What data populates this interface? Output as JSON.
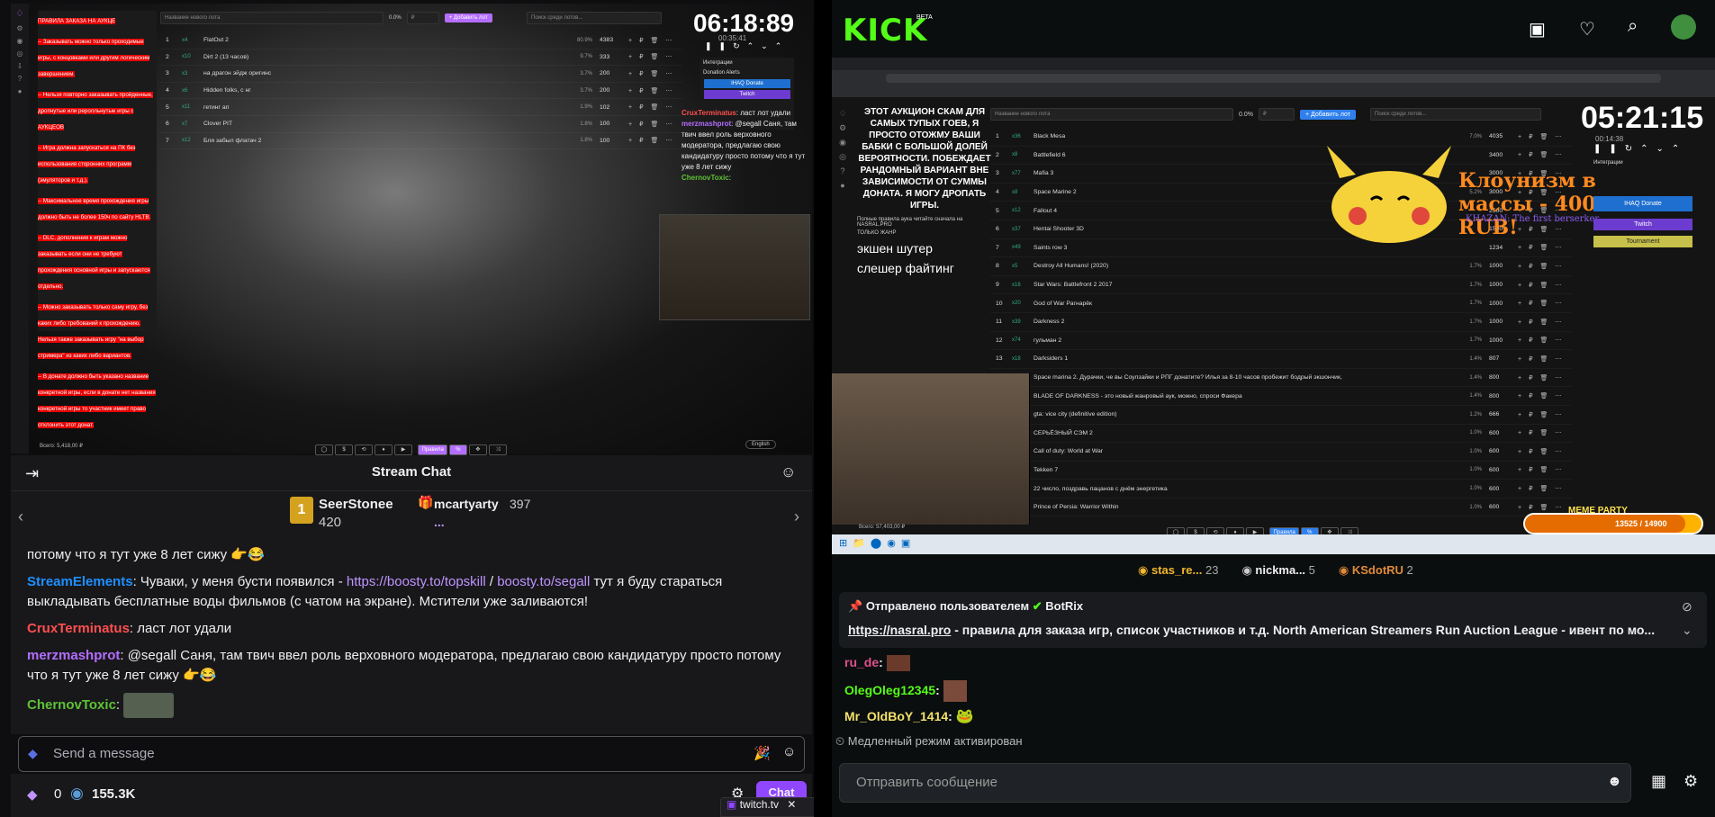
{
  "twitch": {
    "auction": {
      "rules_title": "ПРАВИЛА ЗАКАЗА НА АУКЦЕ",
      "rules": [
        "-- Заказывать можно только проходимые игры, с концовками или другим логическим завершением.",
        "-- Нельзя повторно заказывать пройденные, дропнутые или реролльнутые игры с АУКЦЕОВ",
        "-- Игра должна запускаться на ПК без использования сторонних программ (эмуляторов и т.д.).",
        "-- Максимальное время прохождения игры должно быть не более 150ч по сайту HLTB.",
        "-- DLC, дополнения к играм можно заказывать если они не требуют прохождения основной игры и запускаются отдельно.",
        "-- Можно заказывать только саму игру, без каких либо требований к прохождению. Нельзя также заказывать игру \"на выбор стримера\" из каких либо вариантов.",
        "-- В донате должно быть указано название конкретной игры, если в донате нет названия конкретной игры то участник имеет право отклонить этот донат."
      ],
      "lot_placeholder": "Название нового лота",
      "pct": "0.0%",
      "currency": "₽",
      "add_btn": "+ Добавить лот",
      "search_placeholder": "Поиск среди лотов...",
      "lots": [
        {
          "n": "1",
          "m": "x4",
          "name": "FlatOut 2",
          "pct": "80.9%",
          "val": "4383"
        },
        {
          "n": "2",
          "m": "x10",
          "name": "Dirt 2 (13 часов)",
          "pct": "9.7%",
          "val": "333"
        },
        {
          "n": "3",
          "m": "x3",
          "name": "на драгон эйдж оригинс",
          "pct": "3.7%",
          "val": "200"
        },
        {
          "n": "4",
          "m": "x6",
          "name": "Hidden folks, с нг",
          "pct": "3.7%",
          "val": "200"
        },
        {
          "n": "5",
          "m": "x11",
          "name": "гетинг ап",
          "pct": "1.9%",
          "val": "102"
        },
        {
          "n": "6",
          "m": "x7",
          "name": "Clover PIT",
          "pct": "1.8%",
          "val": "100"
        },
        {
          "n": "7",
          "m": "x12",
          "name": "Бля забыл флатач 2",
          "pct": "1.8%",
          "val": "100"
        }
      ],
      "timer": "06:18:89",
      "timer_small": "00:35:41",
      "integrations": "Интеграции",
      "donation_alerts": "Donation Alerts",
      "ihaq": "IHAQ Donate",
      "twitch_btn": "Twitch",
      "total": "Всего: 5,418,00 ₽",
      "lang": "English",
      "rules_btn": "Правила"
    },
    "overlay_chat": [
      {
        "user": "CruxTerminatus",
        "text": ": ласт лот удали"
      },
      {
        "user": "merzmashprot",
        "text": ": @segall Саня, там твич ввел роль верховного модератора, предлагаю свою кандидатуру просто потому что я тут уже 8 лет сижу"
      },
      {
        "user": "ChernovToxic",
        "text": ":"
      }
    ],
    "chat_title": "Stream Chat",
    "gifters": [
      {
        "rank": "1",
        "name": "SeerStonee",
        "count": "420"
      },
      {
        "rank": "",
        "name": "mcartyarty",
        "count": "397"
      },
      {
        "rank": "",
        "name": "...",
        "count": ""
      }
    ],
    "messages": [
      {
        "user": "",
        "color": "",
        "text": "потому что я тут уже 8 лет сижу"
      },
      {
        "user": "StreamElements",
        "color": "#1e90ff",
        "text": ": Чуваки, у меня бусти появился - ",
        "link1": "https://boosty.to/topskill",
        "sep": " / ",
        "link2": "boosty.to/segall",
        "tail": " тут я буду стараться выкладывать бесплатные воды фильмов (с чатом на экране). Мстители уже заливаются!"
      },
      {
        "user": "CruxTerminatus",
        "color": "#ff4f4f",
        "text": ": ласт лот удали"
      },
      {
        "user": "merzmashprot",
        "color": "#b46eff",
        "text": ": @segall Саня, там твич ввел роль верховного модератора, предлагаю свою кандидатуру просто потому что я тут уже 8 лет сижу"
      },
      {
        "user": "ChernovToxic",
        "color": "#5ec235",
        "text": ":"
      }
    ],
    "input_placeholder": "Send a message",
    "bits": "0",
    "points": "155.3K",
    "chat_btn": "Chat",
    "tab_label": "twitch.tv"
  },
  "kick": {
    "logo": "KICK",
    "beta": "BETA",
    "overlay_left_caps": "ЭТОТ АУКЦИОН СКАМ ДЛЯ САМЫХ ТУПЫХ ГОЕВ, Я ПРОСТО ОТОЖМУ ВАШИ БАБКИ С БОЛЬШОЙ ДОЛЕЙ ВЕРОЯТНОСТИ. ПОБЕЖДАЕТ РАНДОМНЫЙ ВАРИАНТ ВНЕ ЗАВИСИМОСТИ ОТ СУММЫ ДОНАТА. Я МОГУ ДРОПАТЬ ИГРЫ.",
    "overlay_left_small": "Полные правила аука читайте сначала на NASRAL.PRO",
    "only_genre": "ТОЛЬКО ЖАНР",
    "genre1": "экшен шутер",
    "genre2": "слешер файтинг",
    "lot_placeholder": "Название нового лота",
    "pct": "0.0%",
    "currency": "₽",
    "add_btn": "+ Добавить лот",
    "search_placeholder": "Поиск среди лотов...",
    "timer": "05:21:15",
    "timer_small": "00:14:38",
    "integrations": "Интеграции",
    "ihaq": "IHAQ Donate",
    "twitch_btn": "Twitch",
    "tournament": "Tournament",
    "donation_text": "Клоунизм в массы - 400 RUB!",
    "donation_sub": "KHAZAN: The first berserker",
    "lots": [
      {
        "n": "1",
        "m": "x36",
        "name": "Black Mesa",
        "pct": "7.0%",
        "val": "4035"
      },
      {
        "n": "2",
        "m": "x8",
        "name": "Battlefield 6",
        "pct": "",
        "val": "3400"
      },
      {
        "n": "3",
        "m": "x77",
        "name": "Mafia 3",
        "pct": "",
        "val": "3000"
      },
      {
        "n": "4",
        "m": "x8",
        "name": "Space Marine 2",
        "pct": "5.2%",
        "val": "3000"
      },
      {
        "n": "5",
        "m": "x12",
        "name": "Fallout 4",
        "pct": "",
        "val": "2500"
      },
      {
        "n": "6",
        "m": "x37",
        "name": "Hentai Shooter 3D",
        "pct": "",
        "val": "1500"
      },
      {
        "n": "7",
        "m": "x49",
        "name": "Saints row 3",
        "pct": "",
        "val": "1234"
      },
      {
        "n": "8",
        "m": "x5",
        "name": "Destroy All Humans! (2020)",
        "pct": "1.7%",
        "val": "1000"
      },
      {
        "n": "9",
        "m": "x16",
        "name": "Star Wars: Battlefront 2 2017",
        "pct": "1.7%",
        "val": "1000"
      },
      {
        "n": "10",
        "m": "x20",
        "name": "God of War Рагнарёк",
        "pct": "1.7%",
        "val": "1000"
      },
      {
        "n": "11",
        "m": "x39",
        "name": "Darkness 2",
        "pct": "1.7%",
        "val": "1000"
      },
      {
        "n": "12",
        "m": "x74",
        "name": "гульман 2",
        "pct": "1.7%",
        "val": "1000"
      },
      {
        "n": "13",
        "m": "x18",
        "name": "Darksiders 1",
        "pct": "1.4%",
        "val": "807"
      },
      {
        "n": "",
        "m": "",
        "name": "Space marina 2. Дурачки, че вы Соулзайки и РПГ донатите?  Илья за 8-10 часов пробежит бодрый экшончик,",
        "pct": "1.4%",
        "val": "800"
      },
      {
        "n": "",
        "m": "",
        "name": "BLADE OF DARKNESS - это новый жанровый аук, можно, спроси Факера",
        "pct": "1.4%",
        "val": "800"
      },
      {
        "n": "",
        "m": "",
        "name": "gta: vice city (definitive edition)",
        "pct": "1.2%",
        "val": "666"
      },
      {
        "n": "",
        "m": "",
        "name": "СЕРЬЁЗНЫЙ СЭМ 2",
        "pct": "1.0%",
        "val": "600"
      },
      {
        "n": "",
        "m": "",
        "name": "Call of duty: World at War",
        "pct": "1.0%",
        "val": "600"
      },
      {
        "n": "",
        "m": "",
        "name": "Tekken 7",
        "pct": "1.0%",
        "val": "600"
      },
      {
        "n": "",
        "m": "",
        "name": "22 число, поздравь пацанов с днём энергетика",
        "pct": "1.0%",
        "val": "600"
      },
      {
        "n": "",
        "m": "",
        "name": "Prince of Persia: Warrior Within",
        "pct": "1.0%",
        "val": "600"
      }
    ],
    "total": "Всего: 57,403,00 ₽",
    "rules_btn": "Правила",
    "meme_party": "MEME PARTY",
    "meme_progress": "13525 / 14900",
    "meme_progress_value": 0.91,
    "top_gifters": [
      {
        "name": "stas_re...",
        "count": "23"
      },
      {
        "name": "nickma...",
        "count": "5"
      },
      {
        "name": "KSdotRU",
        "count": "2"
      }
    ],
    "pinned_by": "Отправлено пользователем",
    "pinned_user": "BotRix",
    "pinned_link": "https://nasral.pro",
    "pinned_text": " - правила для заказа игр, список участников и т.д. North American Streamers Run Auction League - ивент по мо...",
    "chat": [
      {
        "user": "ru_de",
        "color": "#e0508f"
      },
      {
        "user": "OlegOleg12345",
        "color": "#53fc18"
      },
      {
        "user": "Mr_OldBoY_1414",
        "color": "#f2e06b"
      }
    ],
    "slow_mode": "Медленный режим активирован",
    "input_placeholder": "Отправить сообщение"
  }
}
